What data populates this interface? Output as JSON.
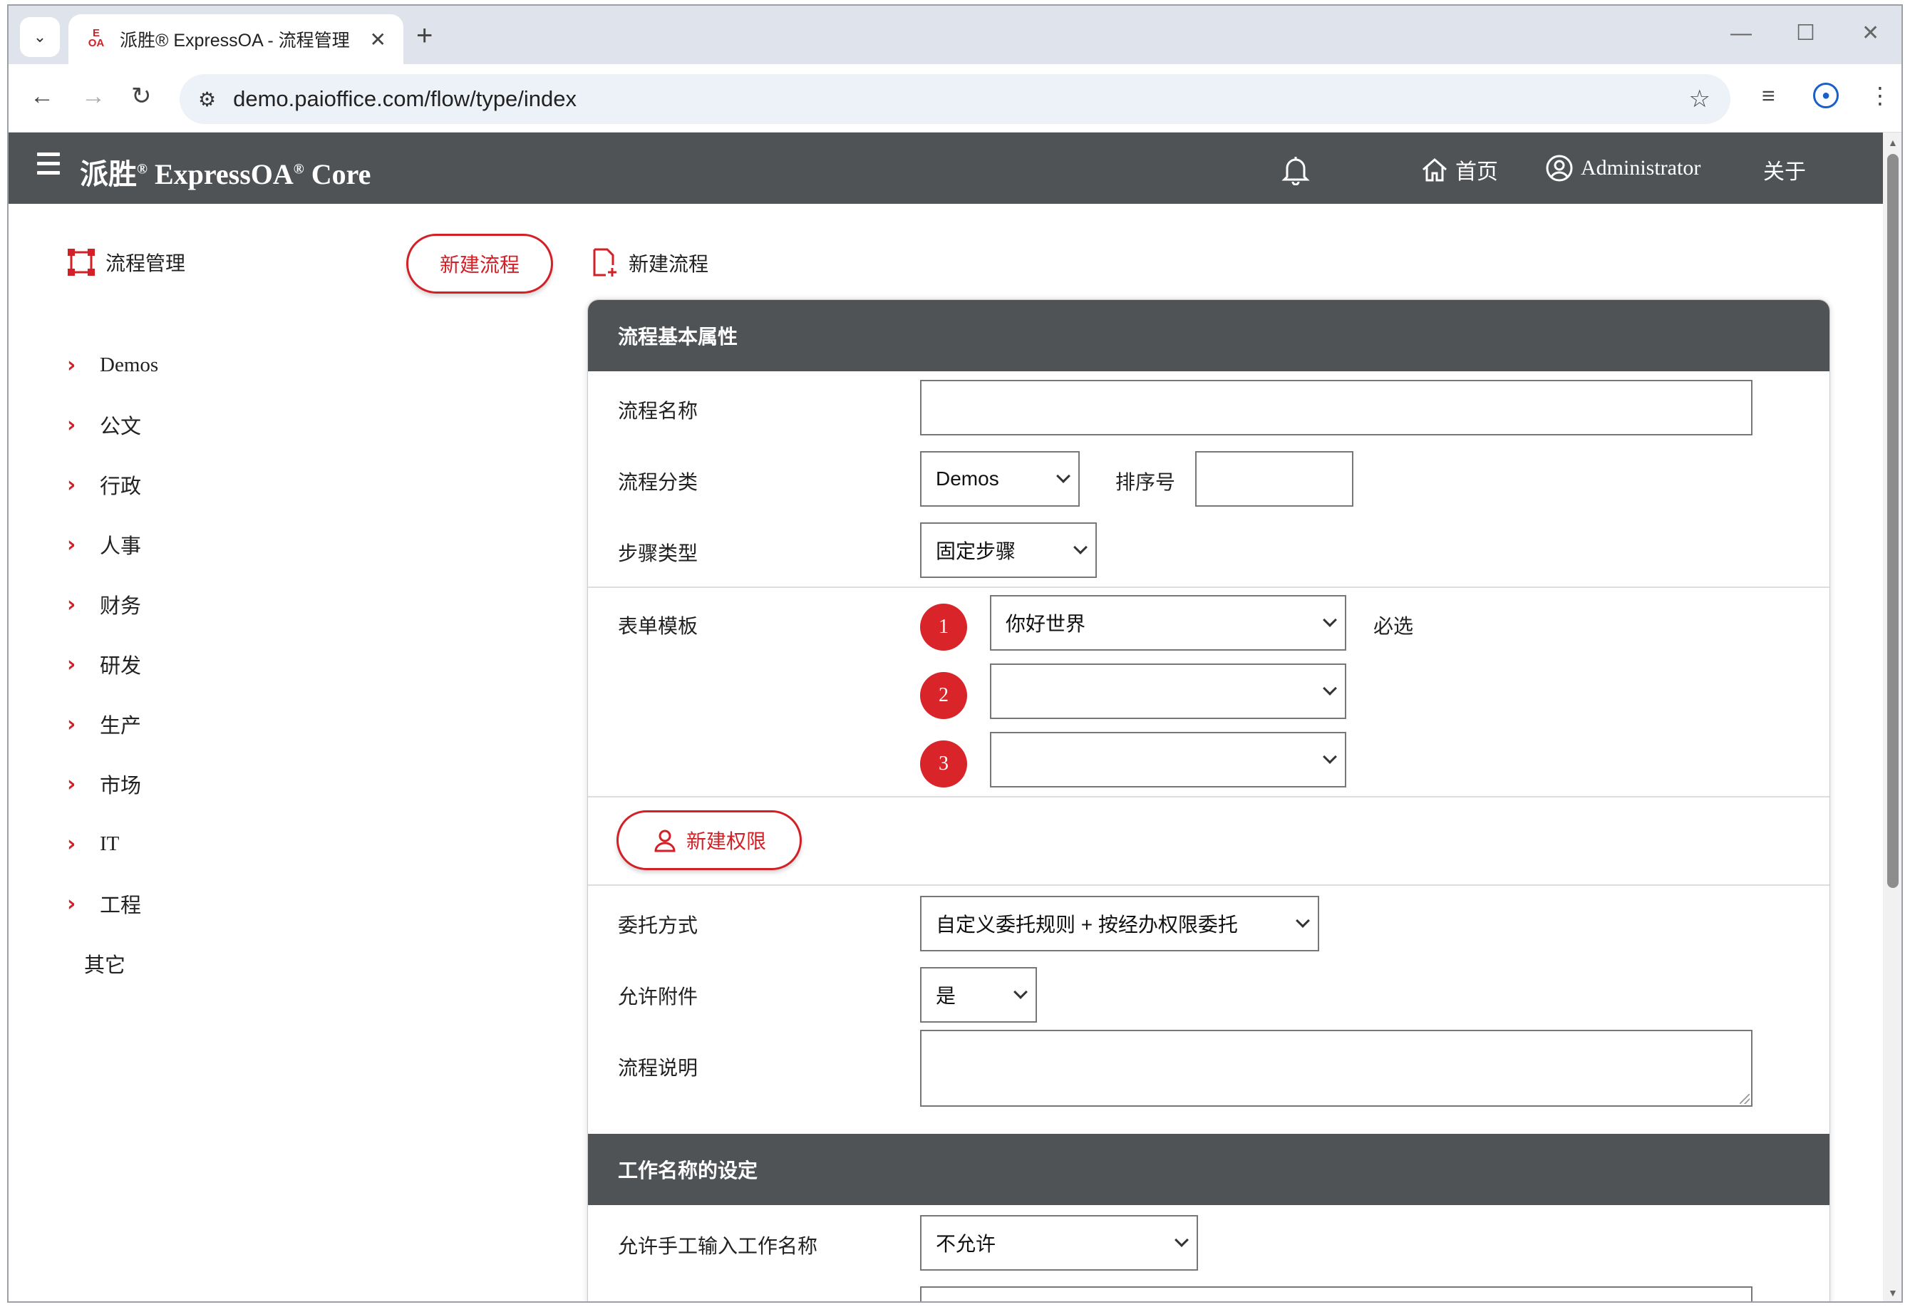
{
  "browser": {
    "tab_title": "派胜® ExpressOA - 流程管理",
    "favicon_text": "E_ OA",
    "url": "demo.paioffice.com/flow/type/index",
    "new_tab": "+",
    "close_tab": "✕"
  },
  "header": {
    "brand": "派胜",
    "brand_mark": "®",
    "brand_product": " ExpressOA",
    "brand_mark2": "®",
    "brand_suffix": " Core",
    "home_label": "首页",
    "user_label": "Administrator",
    "about_label": "关于"
  },
  "sidebar": {
    "title": "流程管理",
    "new_flow_button": "新建流程",
    "items": [
      {
        "label": "Demos",
        "expandable": true
      },
      {
        "label": "公文",
        "expandable": true
      },
      {
        "label": "行政",
        "expandable": true
      },
      {
        "label": "人事",
        "expandable": true
      },
      {
        "label": "财务",
        "expandable": true
      },
      {
        "label": "研发",
        "expandable": true
      },
      {
        "label": "生产",
        "expandable": true
      },
      {
        "label": "市场",
        "expandable": true
      },
      {
        "label": "IT",
        "expandable": true
      },
      {
        "label": "工程",
        "expandable": true
      },
      {
        "label": "其它",
        "expandable": false
      }
    ]
  },
  "main": {
    "title": "新建流程",
    "section1": {
      "heading": "流程基本属性",
      "name_label": "流程名称",
      "name_value": "",
      "category_label": "流程分类",
      "category_value": "Demos",
      "order_label": "排序号",
      "order_value": "",
      "step_type_label": "步骤类型",
      "step_type_value": "固定步骤",
      "form_template_label": "表单模板",
      "templates": [
        {
          "index": "1",
          "value": "你好世界"
        },
        {
          "index": "2",
          "value": ""
        },
        {
          "index": "3",
          "value": ""
        }
      ],
      "required_hint": "必选",
      "new_permission_button": "新建权限",
      "delegate_label": "委托方式",
      "delegate_value": "自定义委托规则 + 按经办权限委托",
      "attachment_label": "允许附件",
      "attachment_value": "是",
      "description_label": "流程说明",
      "description_value": ""
    },
    "section2": {
      "heading": "工作名称的设定",
      "manual_name_label": "允许手工输入工作名称",
      "manual_name_value": "不允许"
    }
  },
  "colors": {
    "accent": "#d32027",
    "header_bg": "#4f5356",
    "badge": "#d9252a"
  }
}
